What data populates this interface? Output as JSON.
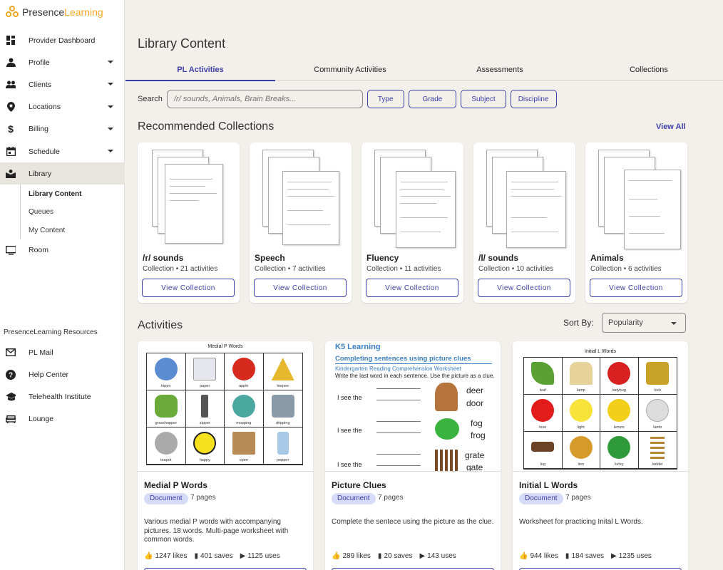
{
  "app": {
    "logo_text_a": "Presence",
    "logo_text_b": "Learning"
  },
  "sidebar": {
    "items": [
      {
        "label": "Provider Dashboard",
        "icon": "dashboard-icon",
        "caret": false
      },
      {
        "label": "Profile",
        "icon": "person-icon",
        "caret": true
      },
      {
        "label": "Clients",
        "icon": "people-icon",
        "caret": true
      },
      {
        "label": "Locations",
        "icon": "location-icon",
        "caret": true
      },
      {
        "label": "Billing",
        "icon": "dollar-icon",
        "caret": true
      },
      {
        "label": "Schedule",
        "icon": "calendar-icon",
        "caret": true
      },
      {
        "label": "Library",
        "icon": "library-icon",
        "caret": false
      }
    ],
    "sub_items": [
      "Library Content",
      "Queues",
      "My Content"
    ],
    "room": {
      "label": "Room",
      "icon": "monitor-icon"
    },
    "resources_title": "PresenceLearning Resources",
    "resources": [
      {
        "label": "PL Mail",
        "icon": "mail-icon"
      },
      {
        "label": "Help Center",
        "icon": "help-icon"
      },
      {
        "label": "Telehealth Institute",
        "icon": "graduation-cap-icon"
      },
      {
        "label": "Lounge",
        "icon": "couch-icon"
      }
    ]
  },
  "main": {
    "title": "Library Content",
    "tabs": [
      "PL Activities",
      "Community Activities",
      "Assessments",
      "Collections"
    ],
    "search": {
      "label": "Search",
      "placeholder": "/r/ sounds, Animals, Brain Breaks..."
    },
    "filters": [
      "Type",
      "Grade",
      "Subject",
      "Discipline"
    ],
    "recommended_title": "Recommended Collections",
    "view_all": "View All",
    "collections": [
      {
        "name": "/r/ sounds",
        "sub": "Collection • 21 activities",
        "button": "View Collection"
      },
      {
        "name": "Speech",
        "sub": "Collection • 7 activities",
        "button": "View Collection"
      },
      {
        "name": "Fluency",
        "sub": "Collection • 11 activities",
        "button": "View Collection"
      },
      {
        "name": "/l/ sounds",
        "sub": "Collection • 10 activities",
        "button": "View Collection"
      },
      {
        "name": "Animals",
        "sub": "Collection • 6 activities",
        "button": "View Collection"
      }
    ],
    "activities_title": "Activities",
    "sort": {
      "label": "Sort By:",
      "value": "Popularity"
    },
    "activities": [
      {
        "name": "Medial P Words",
        "badge": "Document",
        "pages": "7 pages",
        "desc": "Various medial P words with accompanying pictures. 18 words. Multi-page worksheet with common words.",
        "likes": "1247 likes",
        "saves": "401 saves",
        "uses": "1125 uses",
        "sheet_title": "Medial P Words",
        "cells": [
          "hippo",
          "paper",
          "apple",
          "teepee",
          "grasshopper",
          "zipper",
          "mopping",
          "dripping",
          "teapot",
          "happy",
          "open",
          "pepper"
        ]
      },
      {
        "name": "Picture Clues",
        "badge": "Document",
        "pages": "7 pages",
        "desc": "Complete the sentece using the picture as the clue.",
        "likes": "289 likes",
        "saves": "20 saves",
        "uses": "143 uses",
        "sheet_brand": "K5 Learning",
        "sheet_title": "Completing sentences using picture clues",
        "sheet_sub": "Kindergarten Reading Comprehension Worksheet",
        "sheet_instr": "Write the last word in each sentence. Use the picture as a clue.",
        "rows": [
          {
            "lead": "I see the",
            "w1": "deer",
            "w2": "door"
          },
          {
            "lead": "I see the",
            "w1": "fog",
            "w2": "frog"
          },
          {
            "lead": "I see the",
            "w1": "grate",
            "w2": "gate"
          }
        ]
      },
      {
        "name": "Initial L Words",
        "badge": "Document",
        "pages": "7 pages",
        "desc": "Worksheet for practicing Inital L Words.",
        "likes": "944 likes",
        "saves": "184 saves",
        "uses": "1235 uses",
        "sheet_title": "Initial L Words",
        "cells": [
          "leaf",
          "lamp",
          "ladybug",
          "lock",
          "love",
          "light",
          "lemon",
          "lamb",
          "log",
          "lion",
          "lucky",
          "ladder"
        ]
      }
    ]
  },
  "colors": {
    "accent": "#3c3ea8",
    "brand": "#f5a623",
    "badge_bg": "#d6dcf7"
  }
}
